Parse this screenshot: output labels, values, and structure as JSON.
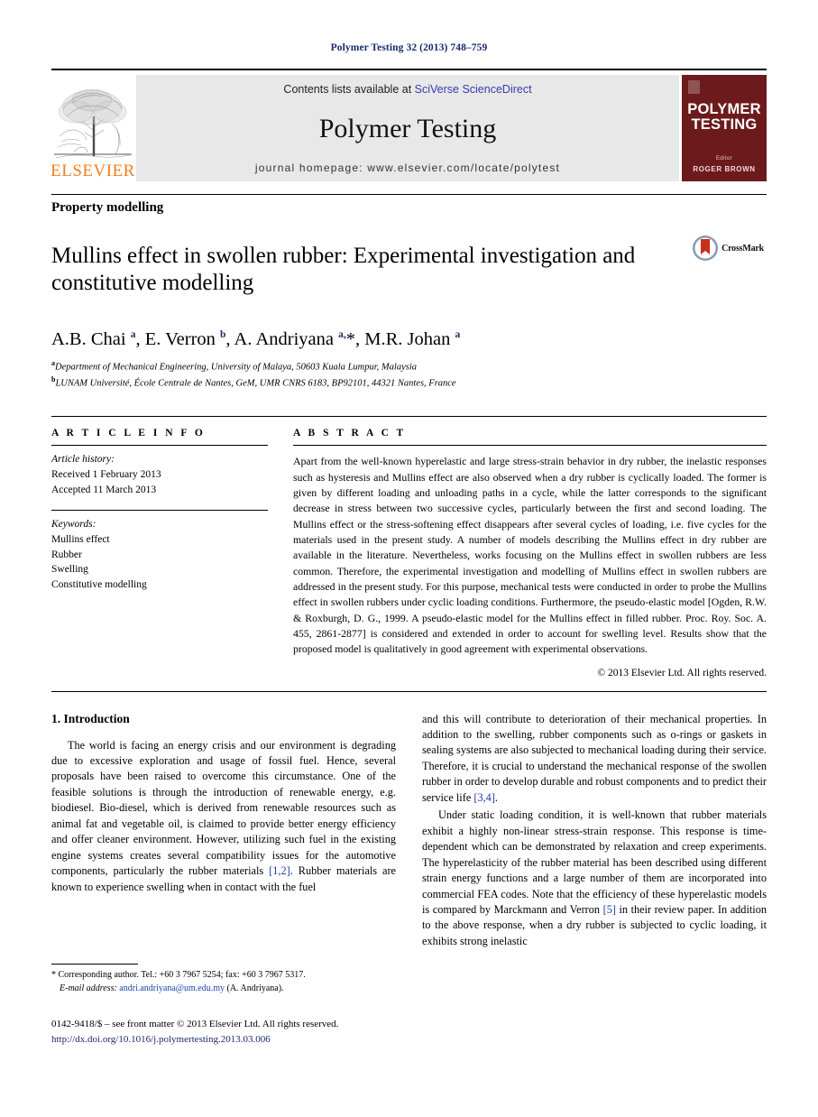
{
  "running_head": "Polymer Testing 32 (2013) 748–759",
  "masthead": {
    "publisher_name": "ELSEVIER",
    "contents_prefix": "Contents lists available at ",
    "contents_link": "SciVerse ScienceDirect",
    "journal_title": "Polymer Testing",
    "homepage": "journal homepage: www.elsevier.com/locate/polytest",
    "cover": {
      "title_line1": "POLYMER",
      "title_line2": "TESTING",
      "editor_label": "Editor",
      "editor_name": "ROGER BROWN",
      "background_color": "#6d1a1c"
    },
    "banner_color": "#e8e8e8",
    "link_color": "#3a3ab0",
    "elsevier_orange": "#F08020"
  },
  "section_label": "Property modelling",
  "title": "Mullins effect in swollen rubber: Experimental investigation and constitutive modelling",
  "crossmark_label": "CrossMark",
  "authors_html": "A.B. Chai <sup>a</sup>, E. Verron <sup>b</sup>, A. Andriyana <sup>a,</sup>*, M.R. Johan <sup>a</sup>",
  "affiliations": [
    {
      "marker": "a",
      "text": "Department of Mechanical Engineering, University of Malaya, 50603 Kuala Lumpur, Malaysia"
    },
    {
      "marker": "b",
      "text": "LUNAM Université, École Centrale de Nantes, GeM, UMR CNRS 6183, BP92101, 44321 Nantes, France"
    }
  ],
  "article_info": {
    "heading": "A R T I C L E   I N F O",
    "history_label": "Article history:",
    "received": "Received 1 February 2013",
    "accepted": "Accepted 11 March 2013",
    "keywords_label": "Keywords:",
    "keywords": [
      "Mullins effect",
      "Rubber",
      "Swelling",
      "Constitutive modelling"
    ]
  },
  "abstract": {
    "heading": "A B S T R A C T",
    "text": "Apart from the well-known hyperelastic and large stress-strain behavior in dry rubber, the inelastic responses such as hysteresis and Mullins effect are also observed when a dry rubber is cyclically loaded. The former is given by different loading and unloading paths in a cycle, while the latter corresponds to the significant decrease in stress between two successive cycles, particularly between the first and second loading. The Mullins effect or the stress-softening effect disappears after several cycles of loading, i.e. five cycles for the materials used in the present study. A number of models describing the Mullins effect in dry rubber are available in the literature. Nevertheless, works focusing on the Mullins effect in swollen rubbers are less common. Therefore, the experimental investigation and modelling of Mullins effect in swollen rubbers are addressed in the present study. For this purpose, mechanical tests were conducted in order to probe the Mullins effect in swollen rubbers under cyclic loading conditions. Furthermore, the pseudo-elastic model [Ogden, R.W. & Roxburgh, D. G., 1999. A pseudo-elastic model for the Mullins effect in filled rubber. Proc. Roy. Soc. A. 455, 2861-2877] is considered and extended in order to account for swelling level. Results show that the proposed model is qualitatively in good agreement with experimental observations.",
    "copyright": "© 2013 Elsevier Ltd. All rights reserved."
  },
  "introduction": {
    "heading": "1.  Introduction",
    "left_p1_a": "The world is facing an energy crisis and our environment is degrading due to excessive exploration and usage of fossil fuel. Hence, several proposals have been raised to overcome this circumstance. One of the feasible solutions is through the introduction of renewable energy, e.g. biodiesel. Bio-diesel, which is derived from renewable resources such as animal fat and vegetable oil, is claimed to provide better energy efficiency and offer cleaner environment. However, utilizing such fuel in the existing engine systems creates several compatibility issues for the automotive components, particularly the rubber materials ",
    "left_p1_ref": "[1,2]",
    "left_p1_b": ". Rubber materials are known to experience swelling when in contact with the fuel",
    "right_p1_a": "and this will contribute to deterioration of their mechanical properties. In addition to the swelling, rubber components such as o-rings or gaskets in sealing systems are also subjected to mechanical loading during their service. Therefore, it is crucial to understand the mechanical response of the swollen rubber in order to develop durable and robust components and to predict their service life ",
    "right_p1_ref": "[3,4]",
    "right_p1_b": ".",
    "right_p2_a": "Under static loading condition, it is well-known that rubber materials exhibit a highly non-linear stress-strain response. This response is time-dependent which can be demonstrated by relaxation and creep experiments. The hyperelasticity of the rubber material has been described using different strain energy functions and a large number of them are incorporated into commercial FEA codes. Note that the efficiency of these hyperelastic models is compared by Marckmann and Verron ",
    "right_p2_ref": "[5]",
    "right_p2_b": " in their review paper. In addition to the above response, when a dry rubber is subjected to cyclic loading, it exhibits strong inelastic"
  },
  "footnote": {
    "corresponding": "* Corresponding author. Tel.: +60 3 7967 5254; fax: +60 3 7967 5317.",
    "email_label": "E-mail address: ",
    "email": "andri.andriyana@um.edu.my",
    "email_suffix": " (A. Andriyana)."
  },
  "imprint": {
    "line1": "0142-9418/$ – see front matter © 2013 Elsevier Ltd. All rights reserved.",
    "doi": "http://dx.doi.org/10.1016/j.polymertesting.2013.03.006"
  }
}
